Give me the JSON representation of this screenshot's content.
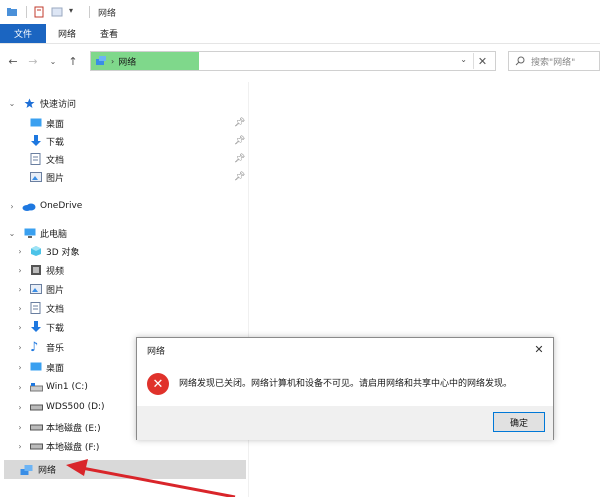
{
  "titlebar": {
    "title": "网络"
  },
  "ribbon": {
    "tabs": [
      "文件",
      "网络",
      "查看"
    ]
  },
  "addressbar": {
    "location": "网络"
  },
  "search": {
    "placeholder": "搜索\"网络\""
  },
  "navpane": {
    "quick_access": {
      "label": "快速访问",
      "items": [
        {
          "label": "桌面",
          "icon": "desktop-icon"
        },
        {
          "label": "下载",
          "icon": "download-icon"
        },
        {
          "label": "文档",
          "icon": "documents-icon"
        },
        {
          "label": "图片",
          "icon": "pictures-icon"
        }
      ]
    },
    "onedrive": {
      "label": "OneDrive"
    },
    "this_pc": {
      "label": "此电脑",
      "items": [
        {
          "label": "3D 对象",
          "icon": "3d-objects-icon"
        },
        {
          "label": "视频",
          "icon": "videos-icon"
        },
        {
          "label": "图片",
          "icon": "pictures-icon"
        },
        {
          "label": "文档",
          "icon": "documents-icon"
        },
        {
          "label": "下载",
          "icon": "download-icon"
        },
        {
          "label": "音乐",
          "icon": "music-icon"
        },
        {
          "label": "桌面",
          "icon": "desktop-icon"
        },
        {
          "label": "Win1 (C:)",
          "icon": "windows-drive-icon"
        },
        {
          "label": "WDS500 (D:)",
          "icon": "drive-icon"
        },
        {
          "label": "本地磁盘 (E:)",
          "icon": "drive-icon"
        },
        {
          "label": "本地磁盘 (F:)",
          "icon": "drive-icon"
        }
      ]
    },
    "network": {
      "label": "网络"
    }
  },
  "dialog": {
    "title": "网络",
    "message": "网络发现已关闭。网络计算机和设备不可见。请启用网络和共享中心中的网络发现。",
    "ok_label": "确定"
  },
  "colors": {
    "accent": "#1b65c1",
    "address_highlight": "#7fd88b",
    "error_red": "#e0322b",
    "arrow_red": "#d9252a"
  }
}
